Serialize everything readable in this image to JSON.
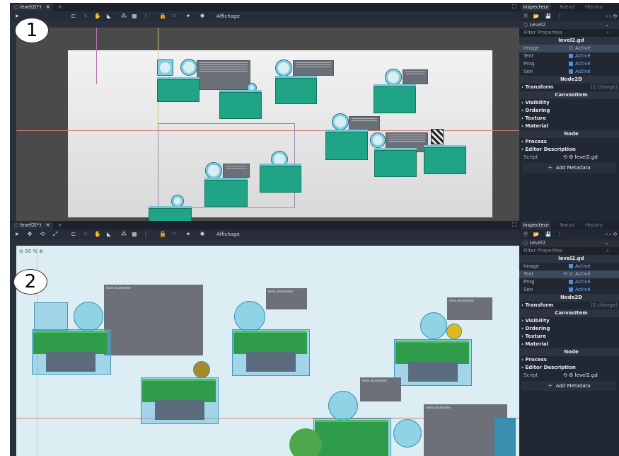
{
  "panels": [
    {
      "badge": "1",
      "tab_title": "level2(*)",
      "tab_close": "✕",
      "tab_add": "+",
      "view_menu": "Affichage",
      "inspector": {
        "tabs": [
          "Inspecteur",
          "Nœud",
          "History"
        ],
        "node_name": "Level2",
        "filter_placeholder": "Filter Properties",
        "script_section": "level2.gd",
        "props": [
          {
            "name": "Image",
            "value": "Activé",
            "checked": false
          },
          {
            "name": "Text",
            "value": "Activé",
            "checked": true
          },
          {
            "name": "Prog",
            "value": "Activé",
            "checked": true
          },
          {
            "name": "Son",
            "value": "Activé",
            "checked": true
          }
        ],
        "node2d_section": "Node2D",
        "transform_label": "Transform",
        "transform_note": "(1 change)",
        "canvasitem_section": "CanvasItem",
        "canvas_groups": [
          "Visibility",
          "Ordering",
          "Texture",
          "Material"
        ],
        "node_section": "Node",
        "node_groups": [
          "Process",
          "Editor Description"
        ],
        "script_label": "Script",
        "script_value": "level2.gd",
        "add_metadata": "Add Metadata"
      }
    },
    {
      "badge": "2",
      "tab_title": "level2(*)",
      "tab_close": "✕",
      "tab_add": "+",
      "view_menu": "Affichage",
      "zoom": "50 %",
      "placeholders": [
        "texte placeholder",
        "texte placeholder",
        "texte placeholder",
        "texte placeholder",
        "texte placeholder"
      ],
      "inspector": {
        "tabs": [
          "Inspecteur",
          "Nœud",
          "History"
        ],
        "node_name": "Level2",
        "filter_placeholder": "Filter Properties",
        "script_section": "level2.gd",
        "props": [
          {
            "name": "Image",
            "value": "Activé",
            "checked": true
          },
          {
            "name": "Text",
            "value": "Activé",
            "checked": false
          },
          {
            "name": "Prog",
            "value": "Activé",
            "checked": true
          },
          {
            "name": "Son",
            "value": "Activé",
            "checked": true
          }
        ],
        "node2d_section": "Node2D",
        "transform_label": "Transform",
        "transform_note": "(1 change)",
        "canvasitem_section": "CanvasItem",
        "canvas_groups": [
          "Visibility",
          "Ordering",
          "Texture",
          "Material"
        ],
        "node_section": "Node",
        "node_groups": [
          "Process",
          "Editor Description"
        ],
        "script_label": "Script",
        "script_value": "level2.gd",
        "add_metadata": "Add Metadata"
      }
    }
  ],
  "colors": {
    "editor_bg": "#222833",
    "accent": "#4a90e2",
    "platform": "#1fa585",
    "sky": "#dceef4"
  }
}
